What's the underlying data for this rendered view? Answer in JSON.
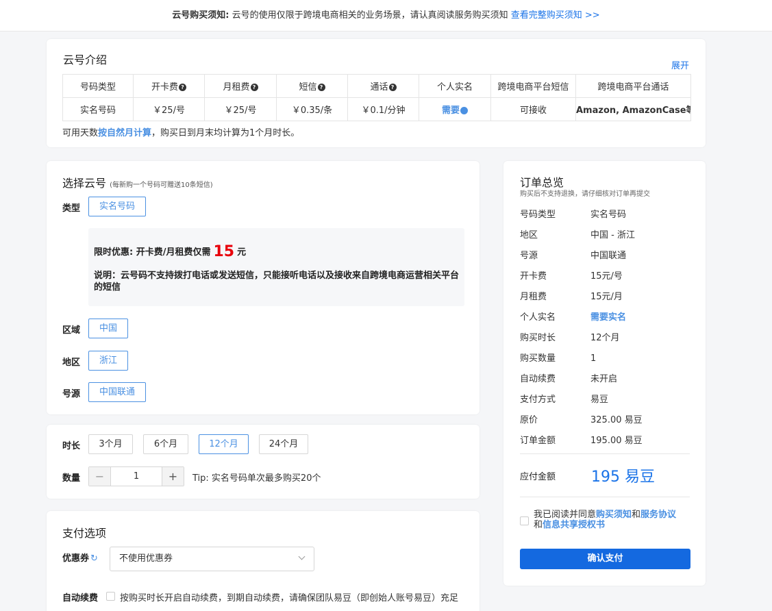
{
  "notice": {
    "label": "云号购买须知:",
    "text": "云号的使用仅限于跨境电商相关的业务场景，请认真阅读服务购买须知",
    "link": "查看完整购买须知 >>"
  },
  "intro": {
    "title": "云号介绍",
    "expand": "展开",
    "headers": [
      "号码类型",
      "开卡费",
      "月租费",
      "短信",
      "通话",
      "个人实名",
      "跨境电商平台短信",
      "跨境电商平台通话"
    ],
    "row": [
      "实名号码",
      "￥25/号",
      "￥25/号",
      "￥0.35/条",
      "￥0.1/分钟",
      "需要",
      "可接收",
      "Amazon, AmazonCase等"
    ],
    "note_pre": "可用天数",
    "note_hl": "按自然月计算",
    "note_post": "，购买日到月末均计算为1个月时长。"
  },
  "select": {
    "title": "选择云号",
    "subtitle": "(每新购一个号码可赠送10条短信)",
    "type_label": "类型",
    "type_value": "实名号码",
    "promo_label": "限时优惠:  开卡费/月租费仅需",
    "promo_price": "15",
    "promo_unit": "元",
    "promo_note": "说明：云号码不支持拨打电话或发送短信，只能接听电话以及接收来自跨境电商运营相关平台的短信",
    "region_label": "区域",
    "region_value": "中国",
    "area_label": "地区",
    "area_value": "浙江",
    "source_label": "号源",
    "source_value": "中国联通"
  },
  "duration": {
    "label": "时长",
    "options": [
      "3个月",
      "6个月",
      "12个月",
      "24个月"
    ],
    "selected": "12个月",
    "qty_label": "数量",
    "qty_minus": "−",
    "qty_value": "1",
    "qty_plus": "+",
    "tip": "Tip: 实名号码单次最多购买20个"
  },
  "payment": {
    "title": "支付选项",
    "coupon_label": "优惠券",
    "coupon_refresh": "↻",
    "coupon_value": "不使用优惠券",
    "auto_label": "自动续费",
    "auto_text": "按购买时长开启自动续费，到期自动续费，请确保团队易豆（即创始人账号易豆）充足"
  },
  "summary": {
    "title": "订单总览",
    "subtitle": "购买后不支持退换，请仔细核对订单再提交",
    "rows": [
      {
        "k": "号码类型",
        "v": "实名号码"
      },
      {
        "k": "地区",
        "v": "中国 - 浙江"
      },
      {
        "k": "号源",
        "v": "中国联通"
      },
      {
        "k": "开卡费",
        "v": "15元/号"
      },
      {
        "k": "月租费",
        "v": "15元/月"
      },
      {
        "k": "个人实名",
        "v": "需要实名"
      },
      {
        "k": "购买时长",
        "v": "12个月"
      },
      {
        "k": "购买数量",
        "v": "1"
      },
      {
        "k": "自动续费",
        "v": "未开启"
      },
      {
        "k": "支付方式",
        "v": "易豆"
      },
      {
        "k": "原价",
        "v": "325.00 易豆"
      },
      {
        "k": "订单金额",
        "v": "195.00 易豆"
      }
    ],
    "pay_label": "应付金额",
    "pay_amount": "195 易豆",
    "agree_pre": "我已阅读并同意",
    "agree_link1": "购买须知",
    "agree_and": "和",
    "agree_link2": "服务协议",
    "agree_and2": "和",
    "agree_link3": "信息共享授权书",
    "confirm": "确认支付"
  },
  "colors": {
    "accent": "#1a73e8",
    "link": "#4a90e2",
    "price": "#e8000b",
    "button": "#1469e0"
  }
}
